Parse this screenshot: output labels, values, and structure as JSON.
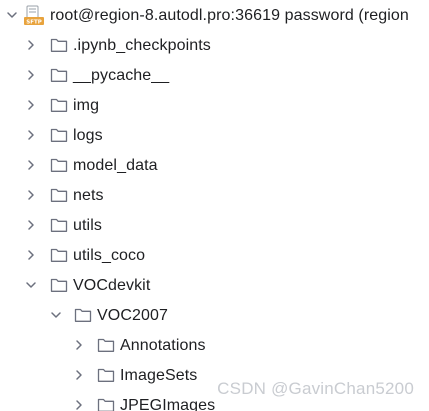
{
  "root": {
    "label": "root@region-8.autodl.pro:36619 password (region",
    "icon_text": "SFTP",
    "expanded": true
  },
  "items": [
    {
      "label": ".ipynb_checkpoints",
      "expanded": false
    },
    {
      "label": "__pycache__",
      "expanded": false
    },
    {
      "label": "img",
      "expanded": false
    },
    {
      "label": "logs",
      "expanded": false
    },
    {
      "label": "model_data",
      "expanded": false
    },
    {
      "label": "nets",
      "expanded": false
    },
    {
      "label": "utils",
      "expanded": false
    },
    {
      "label": "utils_coco",
      "expanded": false
    },
    {
      "label": "VOCdevkit",
      "expanded": true
    },
    {
      "label": "VOC2007",
      "expanded": true
    },
    {
      "label": "Annotations",
      "expanded": false
    },
    {
      "label": "ImageSets",
      "expanded": false
    },
    {
      "label": "JPEGImages",
      "expanded": false
    }
  ],
  "watermark": "CSDN @GavinChan5200",
  "colors": {
    "text": "#1e1f22",
    "chevron": "#6c707e",
    "folder_stroke": "#6c707e",
    "sftp_orange": "#e8a33d",
    "watermark": "#c9ccd1"
  }
}
